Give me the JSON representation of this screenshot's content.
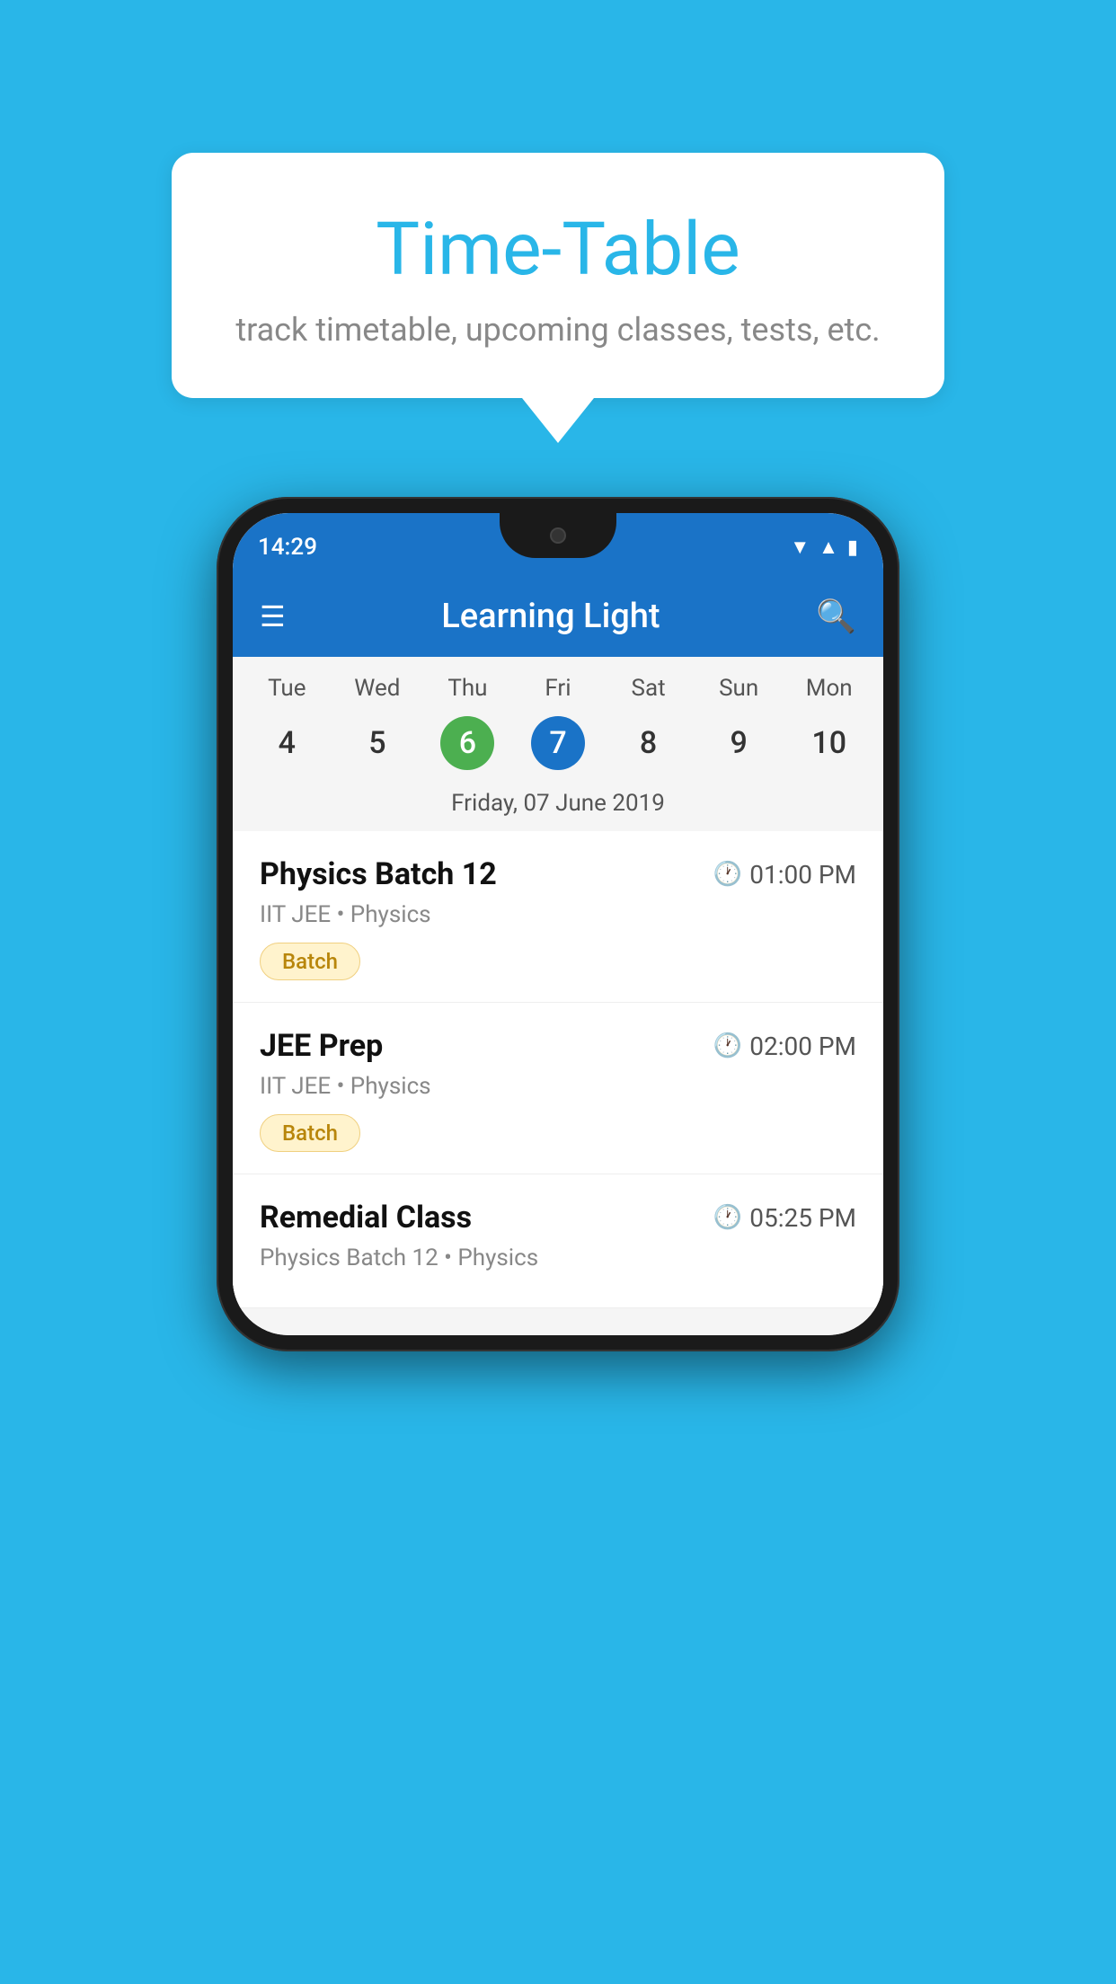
{
  "background_color": "#29B6E8",
  "speech_bubble": {
    "title": "Time-Table",
    "subtitle": "track timetable, upcoming classes, tests, etc."
  },
  "phone": {
    "status_bar": {
      "time": "14:29",
      "icons": [
        "wifi",
        "signal",
        "battery"
      ]
    },
    "app_bar": {
      "title": "Learning Light",
      "menu_icon": "menu",
      "search_icon": "search"
    },
    "calendar": {
      "days": [
        "Tue",
        "Wed",
        "Thu",
        "Fri",
        "Sat",
        "Sun",
        "Mon"
      ],
      "dates": [
        "4",
        "5",
        "6",
        "7",
        "8",
        "9",
        "10"
      ],
      "today_index": 2,
      "selected_index": 3,
      "selected_label": "Friday, 07 June 2019"
    },
    "classes": [
      {
        "name": "Physics Batch 12",
        "time": "01:00 PM",
        "meta": "IIT JEE • Physics",
        "badge": "Batch"
      },
      {
        "name": "JEE Prep",
        "time": "02:00 PM",
        "meta": "IIT JEE • Physics",
        "badge": "Batch"
      },
      {
        "name": "Remedial Class",
        "time": "05:25 PM",
        "meta": "Physics Batch 12 • Physics",
        "badge": ""
      }
    ]
  }
}
